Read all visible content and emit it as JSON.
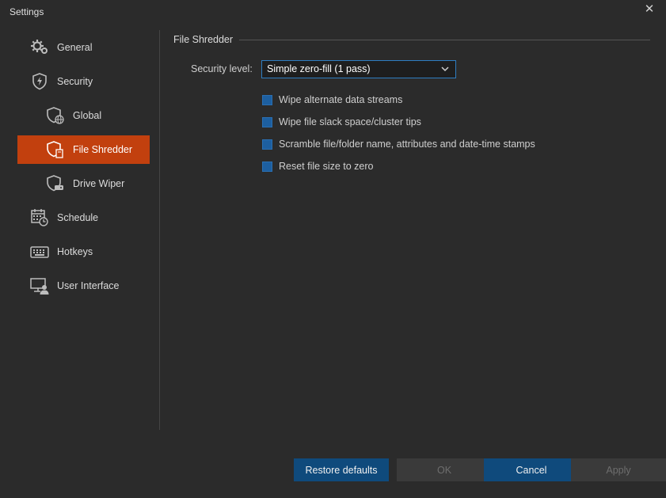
{
  "window": {
    "title": "Settings",
    "close_glyph": "✕"
  },
  "sidebar": {
    "items": [
      {
        "label": "General",
        "icon": "gears-icon"
      },
      {
        "label": "Security",
        "icon": "shield-bolt-icon"
      },
      {
        "label": "Global",
        "icon": "shield-globe-icon"
      },
      {
        "label": "File Shredder",
        "icon": "shield-file-icon",
        "active": true
      },
      {
        "label": "Drive Wiper",
        "icon": "shield-drive-icon"
      },
      {
        "label": "Schedule",
        "icon": "calendar-clock-icon"
      },
      {
        "label": "Hotkeys",
        "icon": "keyboard-icon"
      },
      {
        "label": "User Interface",
        "icon": "monitor-user-icon"
      }
    ]
  },
  "panel": {
    "title": "File Shredder",
    "security_level_label": "Security level:",
    "security_level_value": "Simple zero-fill (1 pass)",
    "options": [
      {
        "label": "Wipe alternate data streams",
        "checked": true
      },
      {
        "label": "Wipe file slack space/cluster tips",
        "checked": true
      },
      {
        "label": "Scramble file/folder name, attributes and date-time stamps",
        "checked": true
      },
      {
        "label": "Reset file size to zero",
        "checked": true
      }
    ]
  },
  "buttons": {
    "restore": "Restore defaults",
    "ok": "OK",
    "cancel": "Cancel",
    "apply": "Apply"
  },
  "colors": {
    "background": "#2b2b2b",
    "active_item": "#c2400e",
    "primary_button": "#0f4a7c",
    "checkbox": "#1d5fa0",
    "select_border": "#2f7dc1"
  }
}
